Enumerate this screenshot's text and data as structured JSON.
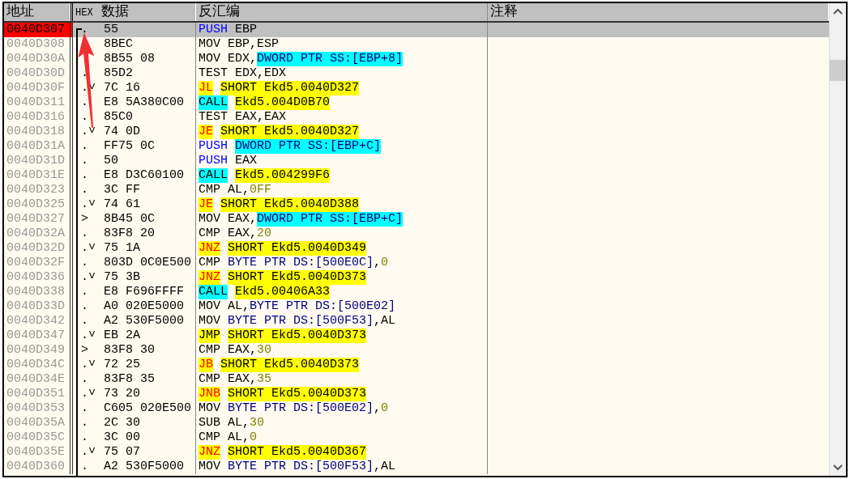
{
  "columns": [
    {
      "label": "地址"
    },
    {
      "prefix": "HEX",
      "label": "数据"
    },
    {
      "label": "反汇编"
    },
    {
      "label": "注释"
    }
  ],
  "rows": [
    {
      "address": "0040D307",
      "marker": ".",
      "hex": "55",
      "selected": true,
      "asm": [
        {
          "kind": "push",
          "text": "PUSH"
        },
        {
          "kind": "plain",
          "text": " EBP"
        }
      ]
    },
    {
      "address": "0040D308",
      "hex": "8BEC",
      "selected": false,
      "asm": [
        {
          "kind": "plain",
          "text": "MOV EBP,ESP"
        }
      ]
    },
    {
      "address": "0040D30A",
      "hex": "8B55 08",
      "selected": false,
      "asm": [
        {
          "kind": "plain",
          "text": "MOV EDX,"
        },
        {
          "kind": "stack",
          "text": "DWORD PTR SS:[EBP+8]"
        }
      ]
    },
    {
      "address": "0040D30D",
      "marker": ".",
      "hex": "85D2",
      "selected": false,
      "asm": [
        {
          "kind": "plain",
          "text": "TEST EDX,EDX"
        }
      ]
    },
    {
      "address": "0040D30F",
      "marker": ".˅",
      "hex": "7C 16",
      "selected": false,
      "asm": [
        {
          "kind": "jcc",
          "text": "JL"
        },
        {
          "kind": "target",
          "text": "SHORT Ekd5.0040D327"
        }
      ]
    },
    {
      "address": "0040D311",
      "marker": ".",
      "hex": "E8 5A380C00",
      "selected": false,
      "asm": [
        {
          "kind": "call",
          "text": "CALL"
        },
        {
          "kind": "target",
          "text": "Ekd5.004D0B70"
        }
      ]
    },
    {
      "address": "0040D316",
      "marker": ".",
      "hex": "85C0",
      "selected": false,
      "asm": [
        {
          "kind": "plain",
          "text": "TEST EAX,EAX"
        }
      ]
    },
    {
      "address": "0040D318",
      "marker": ".˅",
      "hex": "74 0D",
      "selected": false,
      "asm": [
        {
          "kind": "jcc",
          "text": "JE"
        },
        {
          "kind": "target",
          "text": "SHORT Ekd5.0040D327"
        }
      ]
    },
    {
      "address": "0040D31A",
      "marker": ".",
      "hex": "FF75 0C",
      "selected": false,
      "asm": [
        {
          "kind": "push",
          "text": "PUSH"
        },
        {
          "kind": "stack",
          "text": "DWORD PTR SS:[EBP+C]"
        }
      ]
    },
    {
      "address": "0040D31D",
      "marker": ".",
      "hex": "50",
      "selected": false,
      "asm": [
        {
          "kind": "push",
          "text": "PUSH"
        },
        {
          "kind": "plain",
          "text": " EAX"
        }
      ]
    },
    {
      "address": "0040D31E",
      "marker": ".",
      "hex": "E8 D3C60100",
      "selected": false,
      "asm": [
        {
          "kind": "call",
          "text": "CALL"
        },
        {
          "kind": "target",
          "text": "Ekd5.004299F6"
        }
      ]
    },
    {
      "address": "0040D323",
      "marker": ".",
      "hex": "3C FF",
      "selected": false,
      "asm": [
        {
          "kind": "plain",
          "text": "CMP AL,"
        },
        {
          "kind": "const",
          "text": "0FF"
        }
      ]
    },
    {
      "address": "0040D325",
      "marker": ".˅",
      "hex": "74 61",
      "selected": false,
      "asm": [
        {
          "kind": "jcc",
          "text": "JE"
        },
        {
          "kind": "target",
          "text": "SHORT Ekd5.0040D388"
        }
      ]
    },
    {
      "address": "0040D327",
      "marker": ">",
      "hex": "8B45 0C",
      "selected": false,
      "asm": [
        {
          "kind": "plain",
          "text": "MOV EAX,"
        },
        {
          "kind": "stack",
          "text": "DWORD PTR SS:[EBP+C]"
        }
      ]
    },
    {
      "address": "0040D32A",
      "marker": ".",
      "hex": "83F8 20",
      "selected": false,
      "asm": [
        {
          "kind": "plain",
          "text": "CMP EAX,"
        },
        {
          "kind": "const",
          "text": "20"
        }
      ]
    },
    {
      "address": "0040D32D",
      "marker": ".˅",
      "hex": "75 1A",
      "selected": false,
      "asm": [
        {
          "kind": "jcc",
          "text": "JNZ"
        },
        {
          "kind": "target",
          "text": "SHORT Ekd5.0040D349"
        }
      ]
    },
    {
      "address": "0040D32F",
      "marker": ".",
      "hex": "803D 0C0E500",
      "selected": false,
      "asm": [
        {
          "kind": "plain",
          "text": "CMP "
        },
        {
          "kind": "mem",
          "text": "BYTE PTR DS:[500E0C]"
        },
        {
          "kind": "plain",
          "text": ","
        },
        {
          "kind": "const",
          "text": "0"
        }
      ]
    },
    {
      "address": "0040D336",
      "marker": ".˅",
      "hex": "75 3B",
      "selected": false,
      "asm": [
        {
          "kind": "jcc",
          "text": "JNZ"
        },
        {
          "kind": "target",
          "text": "SHORT Ekd5.0040D373"
        }
      ]
    },
    {
      "address": "0040D338",
      "marker": ".",
      "hex": "E8 F696FFFF",
      "selected": false,
      "asm": [
        {
          "kind": "call",
          "text": "CALL"
        },
        {
          "kind": "target",
          "text": "Ekd5.00406A33"
        }
      ]
    },
    {
      "address": "0040D33D",
      "marker": ".",
      "hex": "A0 020E5000",
      "selected": false,
      "asm": [
        {
          "kind": "plain",
          "text": "MOV AL,"
        },
        {
          "kind": "mem",
          "text": "BYTE PTR DS:[500E02]"
        }
      ]
    },
    {
      "address": "0040D342",
      "marker": ".",
      "hex": "A2 530F5000",
      "selected": false,
      "asm": [
        {
          "kind": "plain",
          "text": "MOV "
        },
        {
          "kind": "mem",
          "text": "BYTE PTR DS:[500F53]"
        },
        {
          "kind": "plain",
          "text": ",AL"
        }
      ]
    },
    {
      "address": "0040D347",
      "marker": ".˅",
      "hex": "EB 2A",
      "selected": false,
      "asm": [
        {
          "kind": "jmp",
          "text": "JMP"
        },
        {
          "kind": "target",
          "text": "SHORT Ekd5.0040D373"
        }
      ]
    },
    {
      "address": "0040D349",
      "marker": ">",
      "hex": "83F8 30",
      "selected": false,
      "asm": [
        {
          "kind": "plain",
          "text": "CMP EAX,"
        },
        {
          "kind": "const",
          "text": "30"
        }
      ]
    },
    {
      "address": "0040D34C",
      "marker": ".˅",
      "hex": "72 25",
      "selected": false,
      "asm": [
        {
          "kind": "jcc",
          "text": "JB"
        },
        {
          "kind": "target",
          "text": "SHORT Ekd5.0040D373"
        }
      ]
    },
    {
      "address": "0040D34E",
      "marker": ".",
      "hex": "83F8 35",
      "selected": false,
      "asm": [
        {
          "kind": "plain",
          "text": "CMP EAX,"
        },
        {
          "kind": "const",
          "text": "35"
        }
      ]
    },
    {
      "address": "0040D351",
      "marker": ".˅",
      "hex": "73 20",
      "selected": false,
      "asm": [
        {
          "kind": "jcc",
          "text": "JNB"
        },
        {
          "kind": "target",
          "text": "SHORT Ekd5.0040D373"
        }
      ]
    },
    {
      "address": "0040D353",
      "marker": ".",
      "hex": "C605 020E500",
      "selected": false,
      "asm": [
        {
          "kind": "plain",
          "text": "MOV "
        },
        {
          "kind": "mem",
          "text": "BYTE PTR DS:[500E02]"
        },
        {
          "kind": "plain",
          "text": ","
        },
        {
          "kind": "const",
          "text": "0"
        }
      ]
    },
    {
      "address": "0040D35A",
      "marker": ".",
      "hex": "2C 30",
      "selected": false,
      "asm": [
        {
          "kind": "plain",
          "text": "SUB AL,"
        },
        {
          "kind": "const",
          "text": "30"
        }
      ]
    },
    {
      "address": "0040D35C",
      "marker": ".",
      "hex": "3C 00",
      "selected": false,
      "asm": [
        {
          "kind": "plain",
          "text": "CMP AL,"
        },
        {
          "kind": "const",
          "text": "0"
        }
      ]
    },
    {
      "address": "0040D35E",
      "marker": ".˅",
      "hex": "75 07",
      "selected": false,
      "asm": [
        {
          "kind": "jcc",
          "text": "JNZ"
        },
        {
          "kind": "target",
          "text": "SHORT Ekd5.0040D367"
        }
      ]
    },
    {
      "address": "0040D360",
      "marker": ".",
      "hex": "A2 530F5000",
      "selected": false,
      "asm": [
        {
          "kind": "plain",
          "text": "MOV "
        },
        {
          "kind": "mem",
          "text": "BYTE PTR DS:[500F53]"
        },
        {
          "kind": "plain",
          "text": ",AL"
        }
      ]
    }
  ]
}
